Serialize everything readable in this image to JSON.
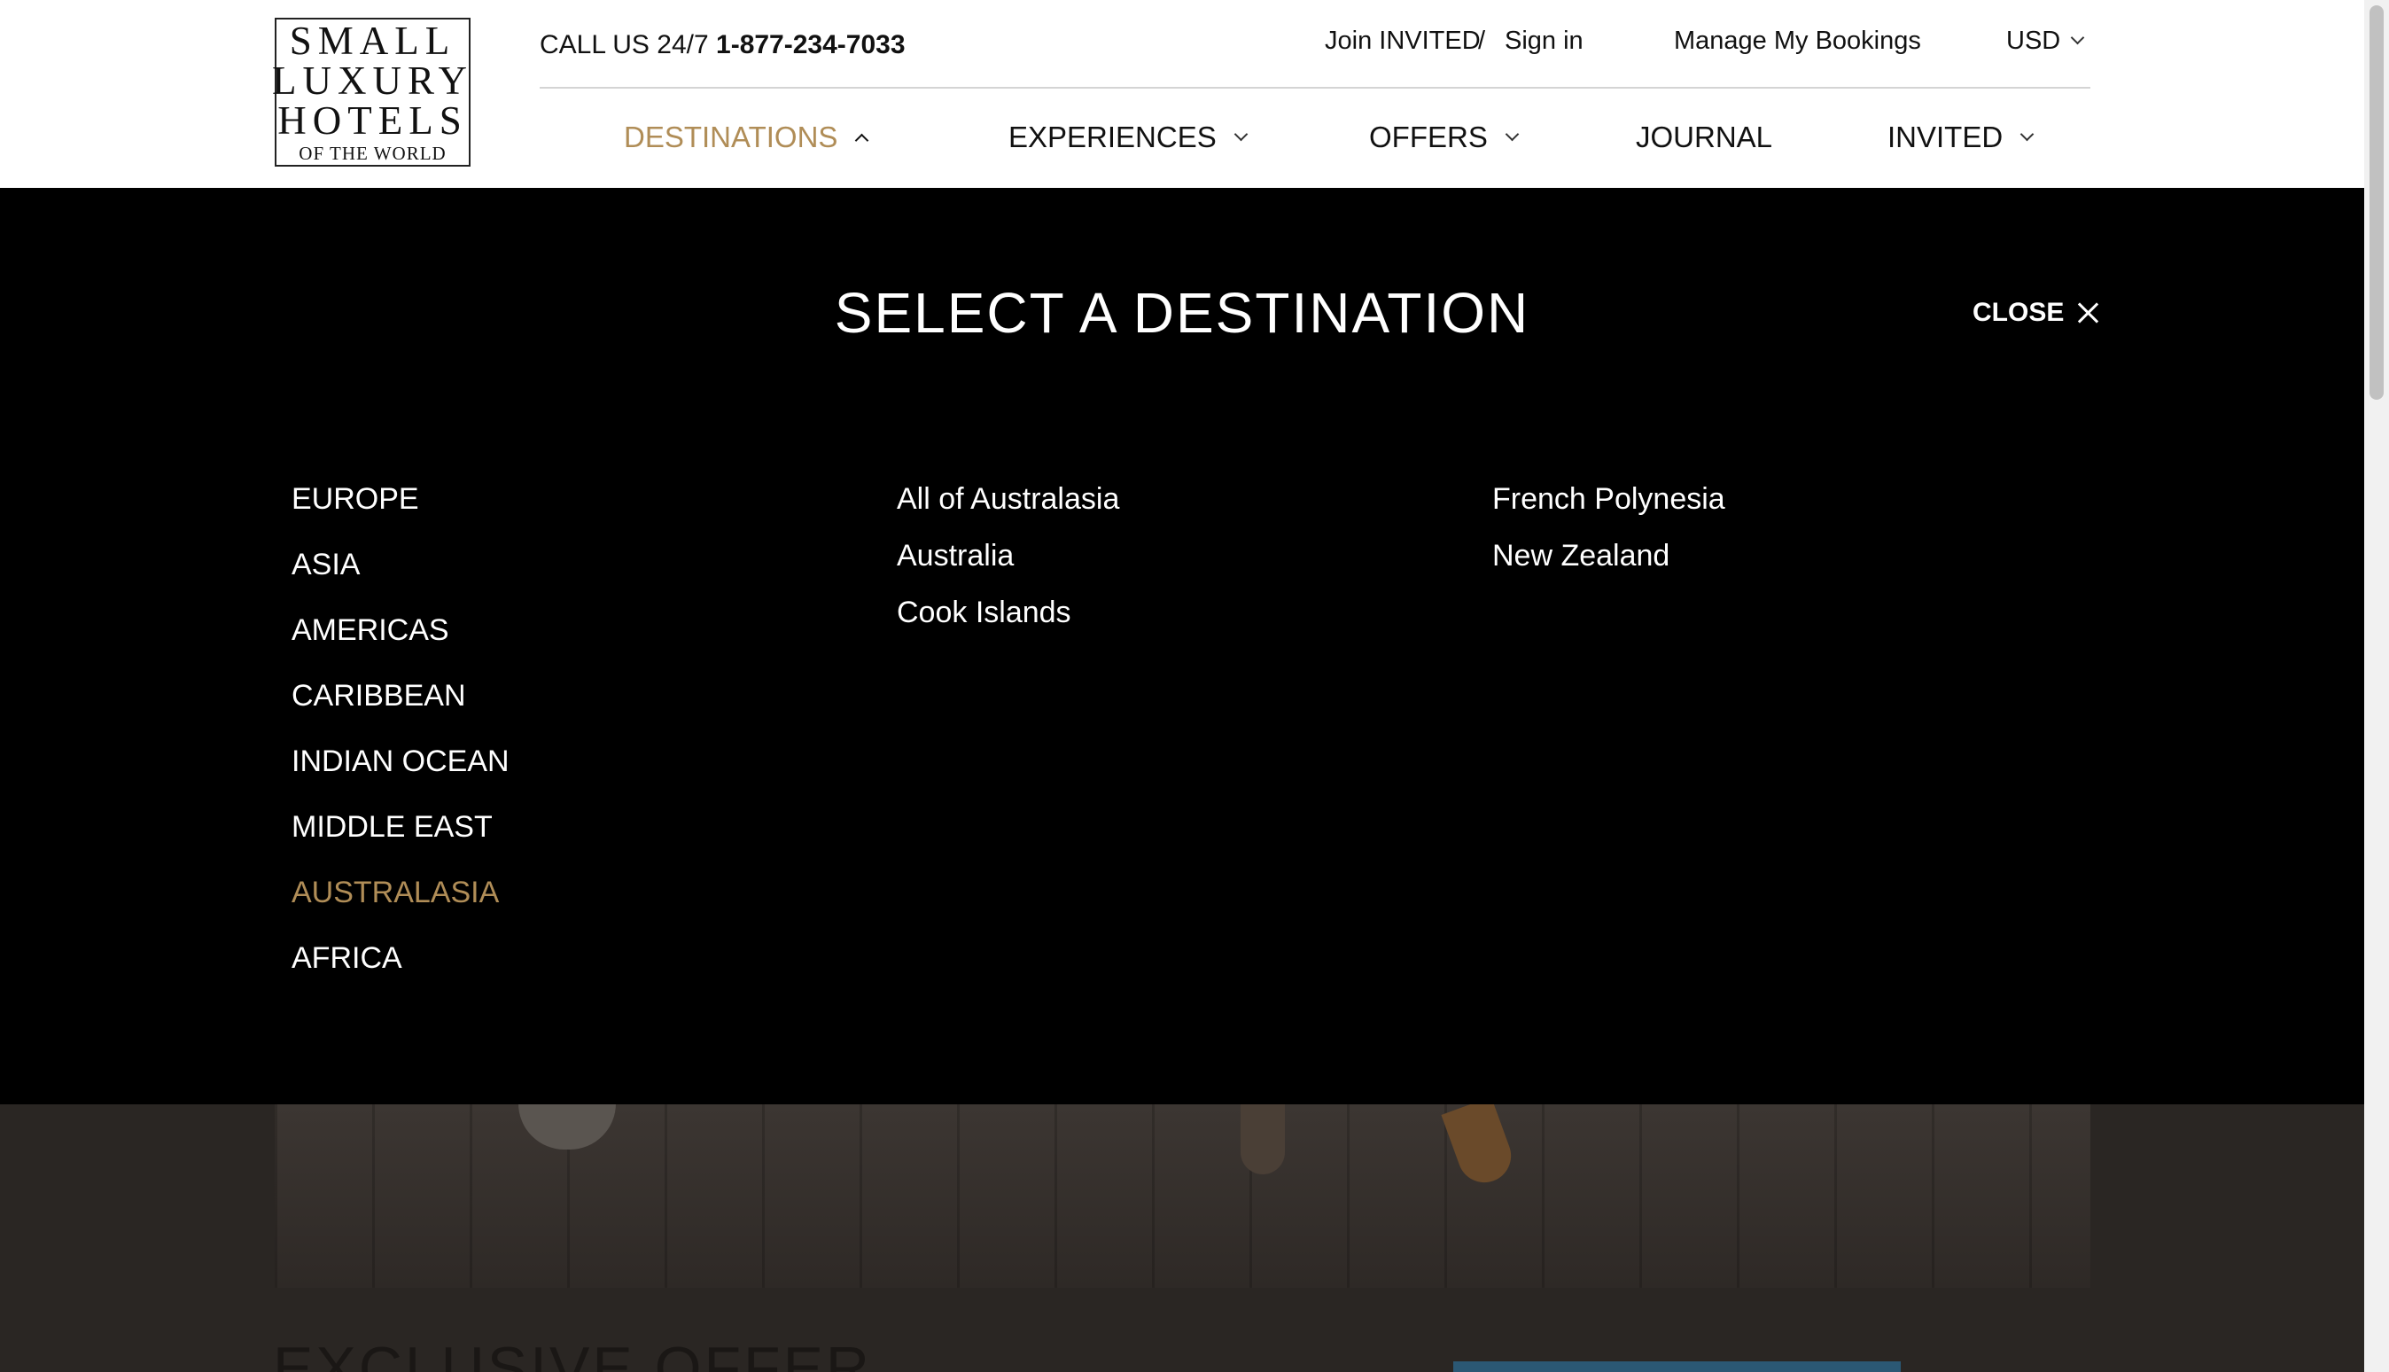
{
  "logo": {
    "lines": [
      "SMALL",
      "LUXURY",
      "HOTELS",
      "OF THE WORLD"
    ]
  },
  "header": {
    "phone_label": "CALL US 24/7",
    "phone_number": "1-877-234-7033",
    "join_label": "Join INVITED",
    "separator": "/",
    "signin_label": "Sign in",
    "bookings_label": "Manage My Bookings",
    "currency": "USD"
  },
  "nav": {
    "destinations": "DESTINATIONS",
    "experiences": "EXPERIENCES",
    "offers": "OFFERS",
    "journal": "JOURNAL",
    "invited": "INVITED"
  },
  "overlay": {
    "title": "SELECT A DESTINATION",
    "close_label": "CLOSE",
    "regions": [
      "EUROPE",
      "ASIA",
      "AMERICAS",
      "CARIBBEAN",
      "INDIAN OCEAN",
      "MIDDLE EAST",
      "AUSTRALASIA",
      "AFRICA"
    ],
    "active_region": "AUSTRALASIA",
    "countries_col1": [
      "All of Australasia",
      "Australia",
      "Cook Islands"
    ],
    "countries_col2": [
      "French Polynesia",
      "New Zealand"
    ]
  },
  "background": {
    "heading": "EXCLUSIVE OFFER"
  },
  "colors": {
    "accent_gold": "#b08d57",
    "overlay_bg": "#000000",
    "header_bg": "#ffffff"
  }
}
